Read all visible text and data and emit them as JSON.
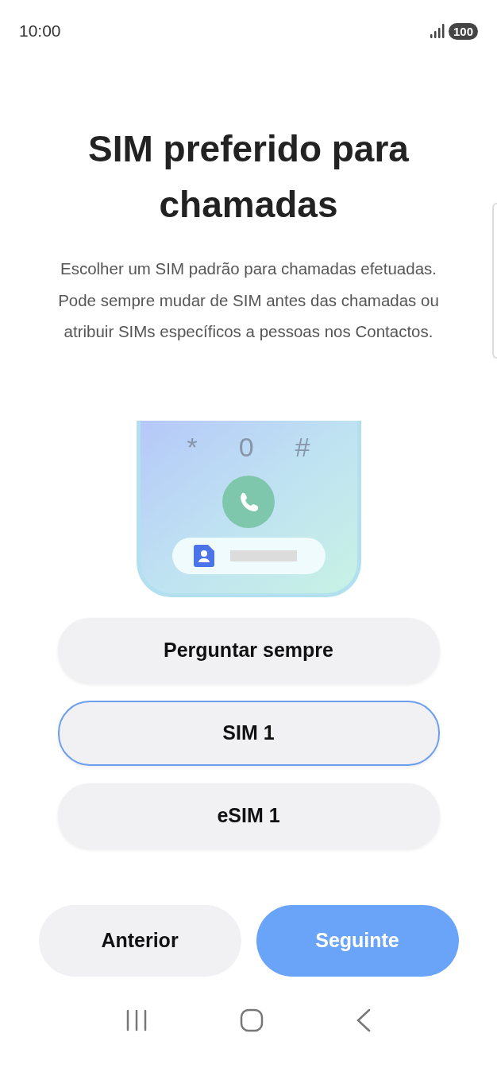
{
  "status_bar": {
    "time": "10:00",
    "battery": "100"
  },
  "title": "SIM preferido para chamadas",
  "description": "Escolher um SIM padrão para chamadas efetuadas. Pode sempre mudar de SIM antes das chamadas ou atribuir SIMs específicos a pessoas nos Contactos.",
  "illustration": {
    "keys": [
      "*",
      "0",
      "#"
    ]
  },
  "options": [
    {
      "label": "Perguntar sempre",
      "selected": false
    },
    {
      "label": "SIM 1",
      "selected": true
    },
    {
      "label": "eSIM 1",
      "selected": false
    }
  ],
  "buttons": [
    {
      "label": "Anterior",
      "kind": "secondary"
    },
    {
      "label": "Seguinte",
      "kind": "primary"
    }
  ]
}
